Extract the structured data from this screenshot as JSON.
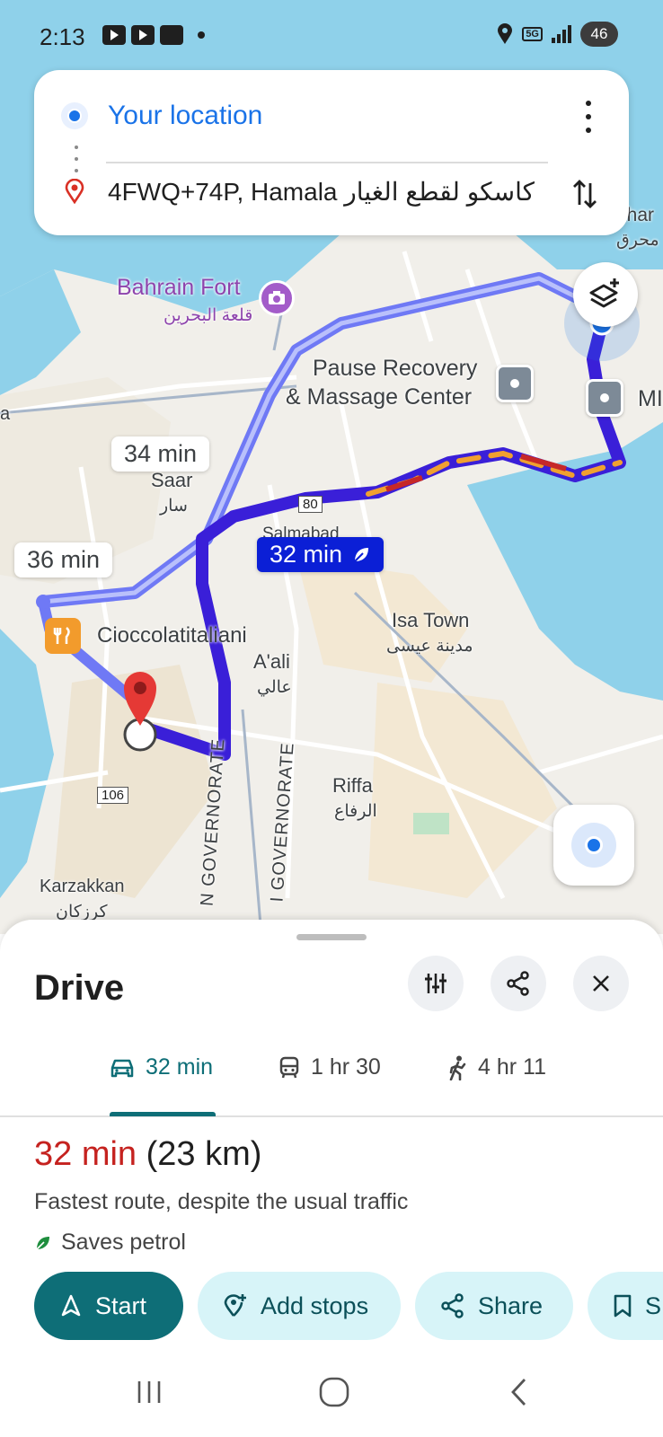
{
  "status_bar": {
    "time": "2:13",
    "network": "5G",
    "battery": "46",
    "notification_icons": [
      "youtube-icon",
      "youtube-icon",
      "home-icon"
    ]
  },
  "directions": {
    "origin": "Your location",
    "destination": "4FWQ+74P, Hamala كاسكو لقطع الغيار"
  },
  "map": {
    "labels": {
      "bahrain_fort": "Bahrain Fort",
      "bahrain_fort_ar": "قلعة البحرين",
      "pause_recovery_1": "Pause Recovery",
      "pause_recovery_2": "& Massage Center",
      "saar": "Saar",
      "saar_ar": "سار",
      "salmabad": "Salmabad",
      "cioccolatitaliani": "Cioccolatitaliani",
      "aali": "A'ali",
      "aali_ar": "عالي",
      "isa_town": "Isa Town",
      "isa_town_ar": "مدينة عيسى",
      "riffa": "Riffa",
      "riffa_ar": "الرفاع",
      "karzakkan": "Karzakkan",
      "karzakkan_ar": "كرزكان",
      "governorate_1": "N GOVERNORATE",
      "governorate_2": "I GOVERNORATE",
      "edge_mi": "MI",
      "edge_uhar": "uhar",
      "edge_ar": "محرق",
      "edge_a": "a"
    },
    "road_shields": {
      "r80": "80",
      "r106": "106"
    },
    "route_times": {
      "alt1": "34 min",
      "alt2": "36 min",
      "selected": "32 min"
    }
  },
  "sheet": {
    "title": "Drive",
    "modes": [
      {
        "label": "32 min",
        "icon": "car-icon",
        "active": true
      },
      {
        "label": "1 hr 30",
        "icon": "transit-icon",
        "active": false
      },
      {
        "label": "4 hr 11",
        "icon": "walk-icon",
        "active": false
      }
    ],
    "duration": "32 min",
    "distance": "(23 km)",
    "route_desc": "Fastest route, despite the usual traffic",
    "eco_label": "Saves petrol",
    "actions": {
      "start": "Start",
      "add_stops": "Add stops",
      "share": "Share",
      "save": "S"
    }
  },
  "colors": {
    "accent_teal": "#0e6e77",
    "route_blue": "#3a1fd8",
    "alt_route": "#6f79f5",
    "duration_red": "#c5221f",
    "water": "#8fd1ea"
  }
}
